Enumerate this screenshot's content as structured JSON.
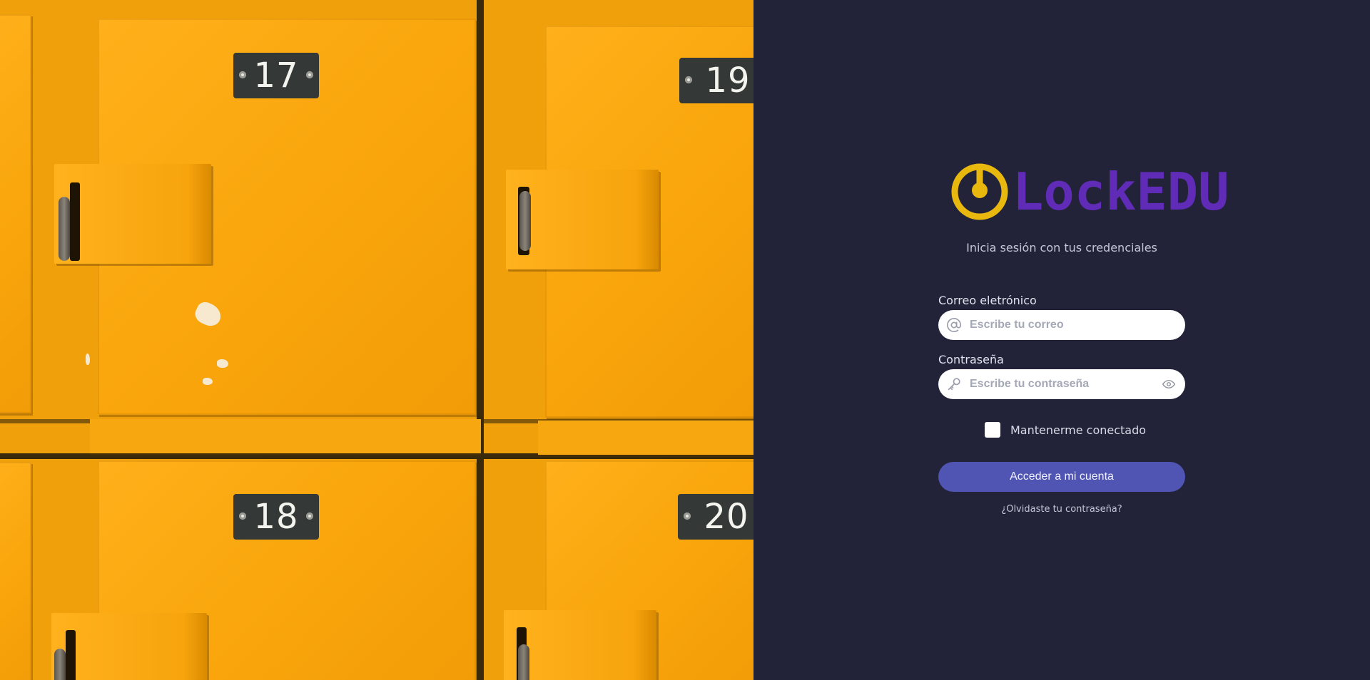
{
  "photo": {
    "locker_numbers": [
      "17",
      "19",
      "18",
      "20"
    ]
  },
  "brand": {
    "name": "LockEDU",
    "logo_icon": "power-icon",
    "name_color": "#5f2bb7",
    "icon_color": "#e8b80f"
  },
  "login": {
    "subtitle": "Inicia sesión con tus credenciales",
    "email": {
      "label": "Correo eletrónico",
      "placeholder": "Escribe tu correo",
      "value": "",
      "icon": "at-sign-icon"
    },
    "password": {
      "label": "Contraseña",
      "placeholder": "Escribe tu contraseña",
      "value": "",
      "icon": "key-icon",
      "toggle_icon": "eye-icon"
    },
    "remember_label": "Mantenerme conectado",
    "remember_checked": false,
    "submit_label": "Acceder a mi cuenta",
    "forgot_label": "¿Olvidaste tu contraseña?"
  },
  "colors": {
    "panel_background": "#222339",
    "button": "#5054b2",
    "locker": "#f9a50b"
  }
}
